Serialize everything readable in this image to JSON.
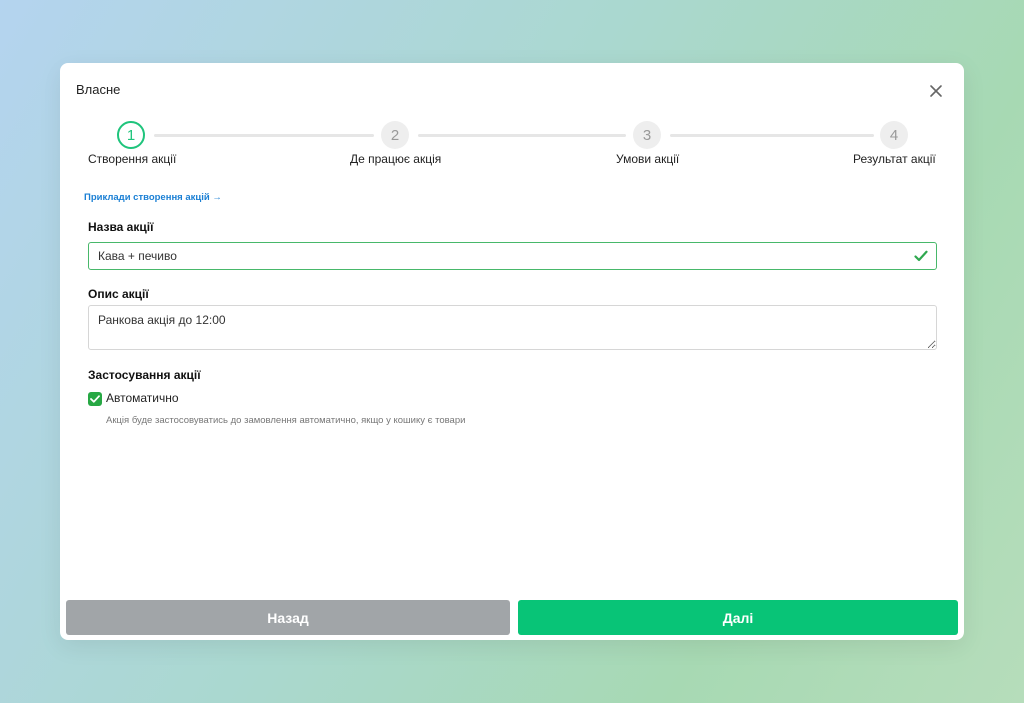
{
  "modal": {
    "title": "Власне",
    "close_icon": "close-icon"
  },
  "stepper": {
    "active_color": "#1fc47c",
    "steps": [
      {
        "number": "1",
        "label": "Створення акції",
        "active": true
      },
      {
        "number": "2",
        "label": "Де працює акція",
        "active": false
      },
      {
        "number": "3",
        "label": "Умови акції",
        "active": false
      },
      {
        "number": "4",
        "label": "Результат акції",
        "active": false
      }
    ]
  },
  "form": {
    "examples_link": "Приклади створення акцій →",
    "name": {
      "label": "Назва акції",
      "value": "Кава + печиво",
      "valid_icon": "check-icon"
    },
    "description": {
      "label": "Опис акції",
      "value": "Ранкова акція до 12:00"
    },
    "application": {
      "label": "Застосування акції",
      "checkbox_label": "Автоматично",
      "checked": true,
      "hint": "Акція буде застосовуватись до замовлення автоматично, якщо у кошику є товари"
    }
  },
  "footer": {
    "back_label": "Назад",
    "next_label": "Далі",
    "back_color": "#a1a5a8",
    "next_color": "#08c477"
  }
}
